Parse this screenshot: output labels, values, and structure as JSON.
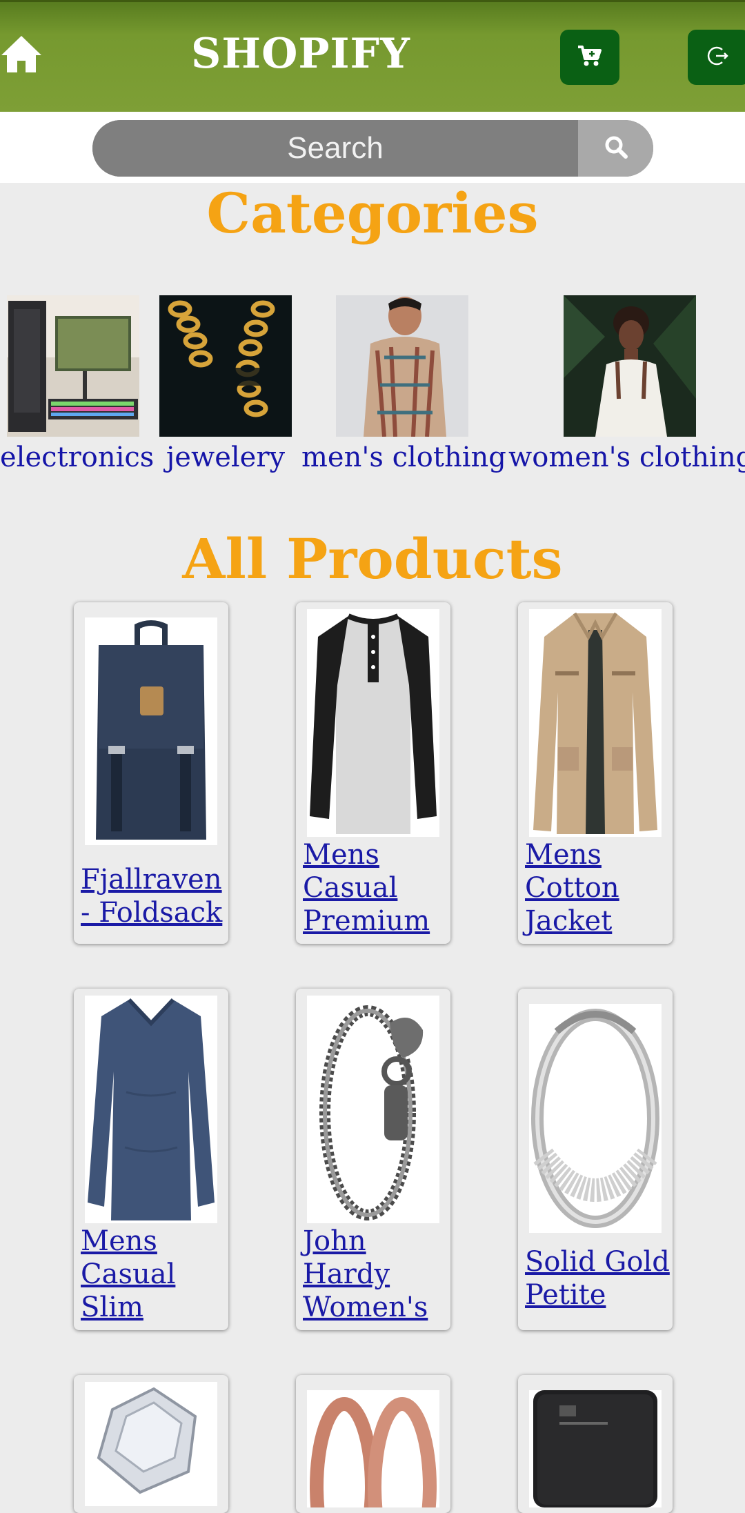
{
  "header": {
    "brand": "SHOPIFY",
    "icons": [
      "home-icon",
      "cart-icon",
      "logout-icon"
    ],
    "colors": {
      "bar": "#7e9f36",
      "button": "#0a6014"
    }
  },
  "search": {
    "placeholder": "Search",
    "button_icon": "search-icon"
  },
  "categories": {
    "title": "Categories",
    "items": [
      {
        "label": "electronics"
      },
      {
        "label": "jewelery"
      },
      {
        "label": "men's clothing"
      },
      {
        "label": "women's clothing"
      }
    ]
  },
  "products": {
    "title": "All Products",
    "items": [
      {
        "name": "Fjallraven - Foldsack"
      },
      {
        "name": "Mens Casual Premium"
      },
      {
        "name": "Mens Cotton Jacket"
      },
      {
        "name": "Mens Casual Slim"
      },
      {
        "name": "John Hardy Women's"
      },
      {
        "name": "Solid Gold Petite"
      }
    ]
  },
  "accent_color": "#f5a314",
  "link_color": "#1a1aa6"
}
